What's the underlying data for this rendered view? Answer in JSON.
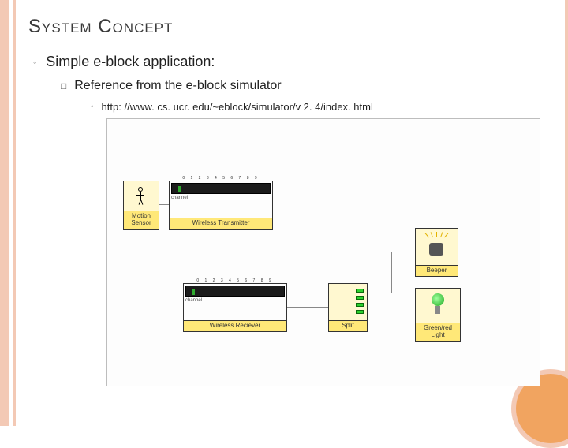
{
  "title": "System Concept",
  "bullets": {
    "main": "Simple e-block application:",
    "sub": "Reference from the e-block simulator",
    "url": "http: //www. cs. ucr. edu/~eblock/simulator/v 2. 4/index. html"
  },
  "diagram": {
    "motion_sensor": "Motion\nSensor",
    "wireless_tx": "Wireless Transmitter",
    "wireless_rx": "Wireless Reciever",
    "split": "Split",
    "beeper": "Beeper",
    "green_light": "Green/red\nLight",
    "dip_numbers": "0 1 2 3 4 5 6 7 8 9",
    "channel": "channel"
  }
}
